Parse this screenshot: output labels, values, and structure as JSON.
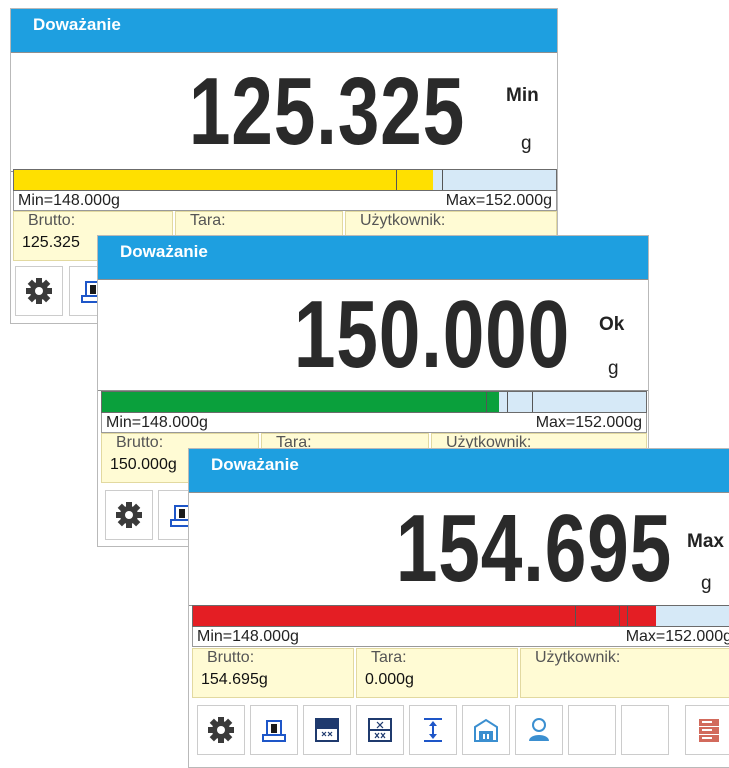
{
  "screens": [
    {
      "title": "Doważanie",
      "value": "125.325",
      "status": "Min",
      "unit": "g",
      "bar_color": "#ffe000",
      "bar_level": 0.773,
      "limit_min": "Min=148.000g",
      "limit_max": "Max=152.000g",
      "brutto_label": "Brutto:",
      "brutto_value": "125.325",
      "tara_label": "Tara:",
      "user_label": "Użytkownik:"
    },
    {
      "title": "Doważanie",
      "value": "150.000",
      "status": "Ok",
      "unit": "g",
      "bar_color": "#0aa03c",
      "bar_level": 0.73,
      "limit_min": "Min=148.000g",
      "limit_max": "Max=152.000g",
      "brutto_label": "Brutto:",
      "brutto_value": "150.000g",
      "tara_label": "Tara:",
      "user_label": "Użytkownik:"
    },
    {
      "title": "Doważanie",
      "value": "154.695",
      "status": "Max",
      "unit": "g",
      "bar_color": "#e41e24",
      "bar_level": 0.83,
      "limit_min": "Min=148.000g",
      "limit_max": "Max=152.000g",
      "brutto_label": "Brutto:",
      "brutto_value": "154.695g",
      "tara_label": "Tara:",
      "tara_value": "0.000g",
      "user_label": "Użytkownik:"
    }
  ],
  "toolbar_icons": [
    "gear-icon",
    "scale-print-icon",
    "dark-grid-icon",
    "tare-grid-icon",
    "height-arrows-icon",
    "box-weight-icon",
    "user-icon",
    "empty-slot",
    "empty-slot",
    "database-icon"
  ]
}
